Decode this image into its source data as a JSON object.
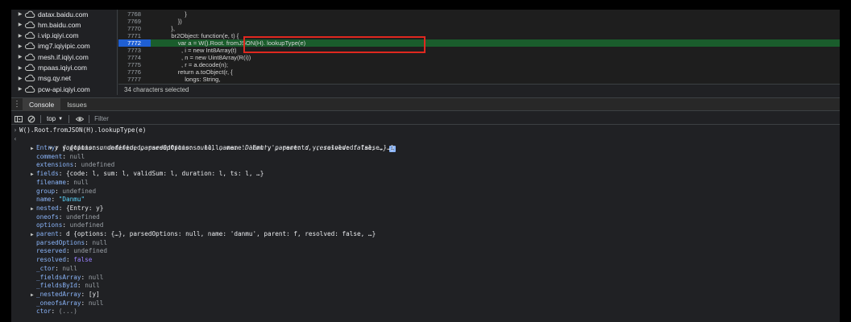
{
  "navigator": {
    "items": [
      {
        "label": "datax.baidu.com"
      },
      {
        "label": "hm.baidu.com"
      },
      {
        "label": "i.vip.iqiyi.com"
      },
      {
        "label": "img7.iqiyipic.com"
      },
      {
        "label": "mesh.if.iqiyi.com"
      },
      {
        "label": "mpaas.iqiyi.com"
      },
      {
        "label": "msg.qy.net"
      },
      {
        "label": "pcw-api.iqiyi.com"
      }
    ]
  },
  "editor": {
    "lines": [
      {
        "num": "7768",
        "text": "                    }"
      },
      {
        "num": "7769",
        "text": "                })"
      },
      {
        "num": "7770",
        "text": "            },"
      },
      {
        "num": "7771",
        "text": "            br2Object: function(e, t) {"
      },
      {
        "num": "7772",
        "text": "                var a = W().Root. fromJSON(H). lookupType(e)"
      },
      {
        "num": "7773",
        "text": "                  , i = new Int8Array(t)"
      },
      {
        "num": "7774",
        "text": "                  , n = new Uint8Array(R(i))"
      },
      {
        "num": "7775",
        "text": "                  , r = a.decode(n);"
      },
      {
        "num": "7776",
        "text": "                return a.toObject(r, {"
      },
      {
        "num": "7777",
        "text": "                    longs: String,"
      }
    ],
    "status": "34 characters selected"
  },
  "drawer": {
    "tabs": [
      "Console",
      "Issues"
    ]
  },
  "console_toolbar": {
    "context": "top",
    "filter_placeholder": "Filter"
  },
  "console": {
    "input": "W().Root.fromJSON(H).lookupType(e)",
    "summary": "y {options: undefined, parsedOptions: null, name: 'Danmu', parent: d, resolved: false, …}",
    "props": [
      {
        "expand": true,
        "key": "Entry",
        "value": "y {options: undefined, parsedOptions: null, name: 'Entry', parent: y, resolved: false, …}"
      },
      {
        "expand": false,
        "key": "comment",
        "value": "null"
      },
      {
        "expand": false,
        "key": "extensions",
        "value": "undefined"
      },
      {
        "expand": true,
        "key": "fields",
        "value": "{code: l, sum: l, validSum: l, duration: l, ts: l, …}"
      },
      {
        "expand": false,
        "key": "filename",
        "value": "null"
      },
      {
        "expand": false,
        "key": "group",
        "value": "undefined"
      },
      {
        "expand": false,
        "key": "name",
        "value": "\"Danmu\""
      },
      {
        "expand": true,
        "key": "nested",
        "value": "{Entry: y}"
      },
      {
        "expand": false,
        "key": "oneofs",
        "value": "undefined"
      },
      {
        "expand": false,
        "key": "options",
        "value": "undefined"
      },
      {
        "expand": true,
        "key": "parent",
        "value": "d {options: {…}, parsedOptions: null, name: 'danmu', parent: f, resolved: false, …}"
      },
      {
        "expand": false,
        "key": "parsedOptions",
        "value": "null"
      },
      {
        "expand": false,
        "key": "reserved",
        "value": "undefined"
      },
      {
        "expand": false,
        "key": "resolved",
        "value": "false"
      },
      {
        "expand": false,
        "key": "_ctor",
        "value": "null"
      },
      {
        "expand": false,
        "key": "_fieldsArray",
        "value": "null"
      },
      {
        "expand": false,
        "key": "_fieldsById",
        "value": "null"
      },
      {
        "expand": true,
        "key": "_nestedArray",
        "value": "[y]"
      },
      {
        "expand": false,
        "key": "_oneofsArray",
        "value": "null"
      },
      {
        "expand": false,
        "key": "ctor",
        "value": "(...)"
      }
    ]
  },
  "colors": {
    "active_line_bg": "#1a5d2c",
    "active_line_number_bg": "#1f5fd3",
    "highlight_box": "#e0281f",
    "key": "#8ab4f8",
    "string": "#f28b82",
    "null": "#9aa0a6",
    "boolean": "#9980ff"
  },
  "icons": {
    "sidebar_toggle": "sidebar-toggle-icon",
    "clear": "clear-console-icon",
    "eye": "live-expression-eye-icon",
    "cloud": "cloud-icon",
    "menu": "kebab-menu-icon"
  }
}
